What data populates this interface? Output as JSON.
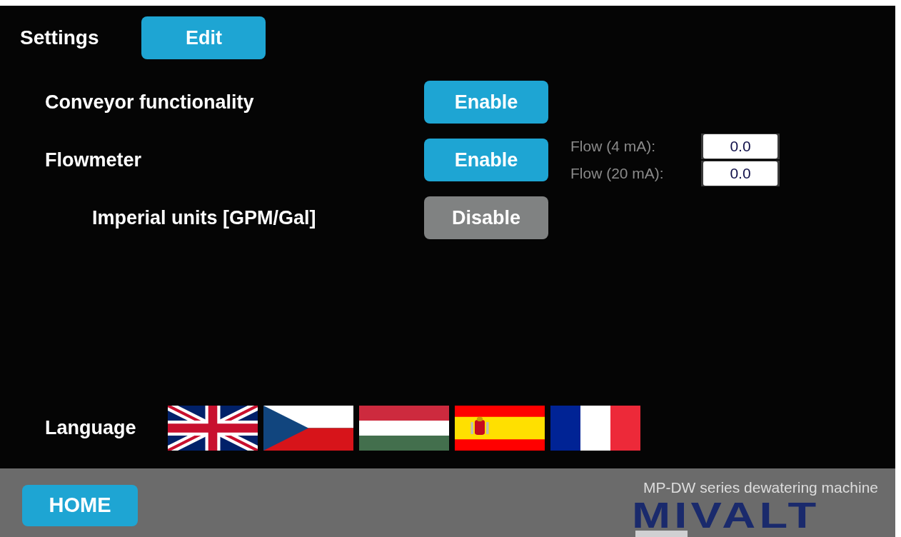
{
  "header": {
    "title": "Settings",
    "edit_button": "Edit"
  },
  "settings": [
    {
      "label": "Conveyor functionality",
      "button": "Enable",
      "enabled": true,
      "indented": false
    },
    {
      "label": "Flowmeter",
      "button": "Enable",
      "enabled": true,
      "indented": false,
      "fields": [
        {
          "label": "Flow (4 mA):",
          "value": "0.0"
        },
        {
          "label": "Flow (20 mA):",
          "value": "0.0"
        }
      ]
    },
    {
      "label": "Imperial units [GPM/Gal]",
      "button": "Disable",
      "enabled": false,
      "indented": true
    }
  ],
  "language": {
    "label": "Language"
  },
  "footer": {
    "home_button": "HOME",
    "subtitle": "MP-DW series dewatering machine",
    "logo": "MIVALT"
  }
}
